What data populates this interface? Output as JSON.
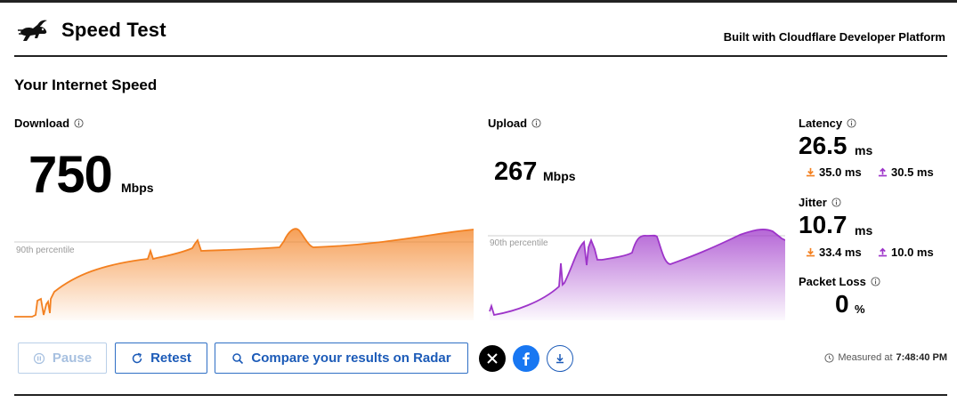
{
  "header": {
    "title": "Speed Test",
    "built_with": "Built with Cloudflare Developer Platform",
    "logo_icon": "rabbit-icon"
  },
  "section_title": "Your Internet Speed",
  "download": {
    "label": "Download",
    "value": "750",
    "unit": "Mbps",
    "percentile_label": "90th percentile",
    "color": "#f38020"
  },
  "upload": {
    "label": "Upload",
    "value": "267",
    "unit": "Mbps",
    "percentile_label": "90th percentile",
    "color": "#9d34c9"
  },
  "latency": {
    "label": "Latency",
    "value": "26.5",
    "unit": "ms",
    "down_value": "35.0 ms",
    "up_value": "30.5 ms"
  },
  "jitter": {
    "label": "Jitter",
    "value": "10.7",
    "unit": "ms",
    "down_value": "33.4 ms",
    "up_value": "10.0 ms"
  },
  "packet_loss": {
    "label": "Packet Loss",
    "value": "0",
    "unit": "%"
  },
  "buttons": {
    "pause": "Pause",
    "retest": "Retest",
    "compare": "Compare your results on Radar"
  },
  "measured": {
    "prefix": "Measured at",
    "time": "7:48:40 PM"
  },
  "colors": {
    "accent_blue": "#1c5bb8",
    "download_orange": "#f38020",
    "upload_purple": "#9d34c9",
    "facebook_blue": "#1877f2"
  }
}
